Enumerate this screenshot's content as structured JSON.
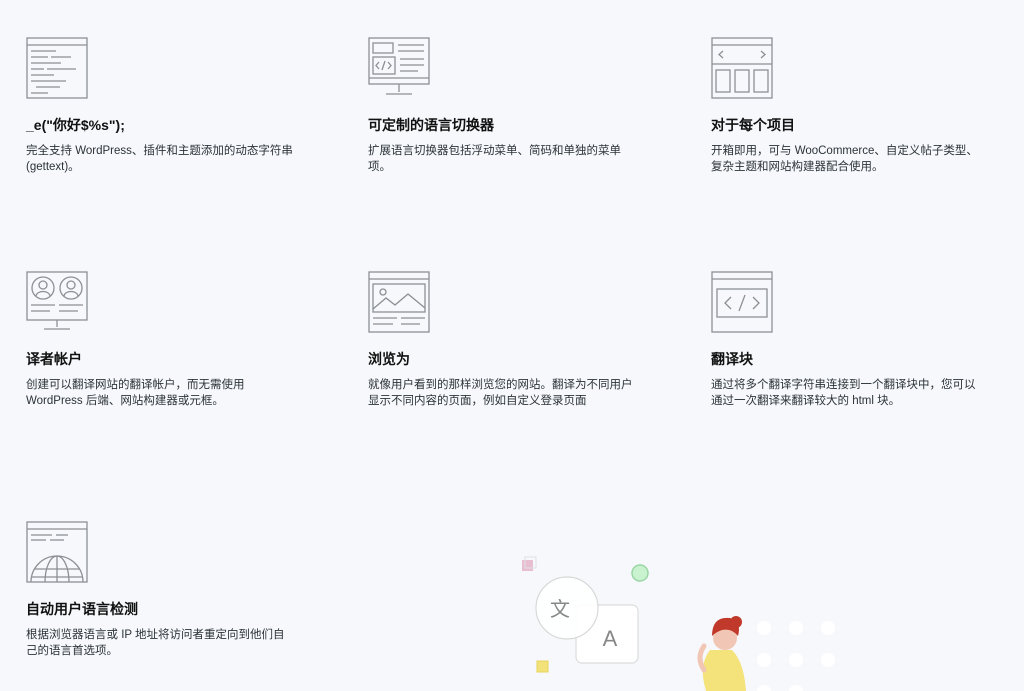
{
  "features": [
    {
      "id": "gettext",
      "icon": "code-document-icon",
      "title": "_e(\"你好$%s\");",
      "desc": "完全支持 WordPress、插件和主题添加的动态字符串 (gettext)。"
    },
    {
      "id": "switcher",
      "icon": "monitor-code-icon",
      "title": "可定制的语言切换器",
      "desc": "扩展语言切换器包括浮动菜单、简码和单独的菜单项。"
    },
    {
      "id": "every-item",
      "icon": "browser-carousel-icon",
      "title": "对于每个项目",
      "desc": "开箱即用，可与 WooCommerce、自定义帖子类型、复杂主题和网站构建器配合使用。"
    },
    {
      "id": "translator-accounts",
      "icon": "monitor-users-icon",
      "title": "译者帐户",
      "desc": "创建可以翻译网站的翻译帐户，而无需使用 WordPress 后端、网站构建器或元框。"
    },
    {
      "id": "browse-as",
      "icon": "browser-image-icon",
      "title": "浏览为",
      "desc": "就像用户看到的那样浏览您的网站。翻译为不同用户显示不同内容的页面，例如自定义登录页面"
    },
    {
      "id": "translation-blocks",
      "icon": "browser-code-icon",
      "title": "翻译块",
      "desc": "通过将多个翻译字符串连接到一个翻译块中，您可以通过一次翻译来翻译较大的 html 块。"
    },
    {
      "id": "auto-detect",
      "icon": "browser-globe-icon",
      "title": "自动用户语言检测",
      "desc": "根据浏览器语言或 IP 地址将访问者重定向到他们自己的语言首选项。"
    }
  ],
  "illustration": {
    "bubble_left_glyph": "文",
    "bubble_right_glyph": "A",
    "colors": {
      "pink": "#e7bfd0",
      "green": "#c9f2cf",
      "yellow": "#f3e27a",
      "hair": "#c0392b",
      "shirt": "#f4e27a",
      "skin": "#f2c6b4"
    }
  }
}
